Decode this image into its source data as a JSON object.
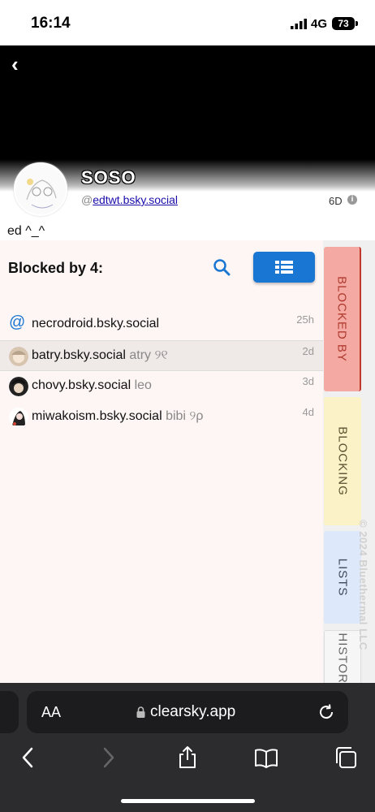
{
  "status_bar": {
    "time": "16:14",
    "network": "4G",
    "battery": "73"
  },
  "profile": {
    "display_name": "SOSO",
    "handle_prefix": "@",
    "handle": "edtwt.bsky.social",
    "age": "6D",
    "bio": "ed ^_^"
  },
  "panel": {
    "title": "Blocked by 4:",
    "rows": [
      {
        "handle": "necrodroid.bsky.social",
        "alias": "",
        "time": "25h",
        "avatar": "at-icon"
      },
      {
        "handle": "batry.bsky.social",
        "alias": "atry ୨୧",
        "time": "2d",
        "avatar": "avatar"
      },
      {
        "handle": "chovy.bsky.social",
        "alias": "leo",
        "time": "3d",
        "avatar": "avatar"
      },
      {
        "handle": "miwakoism.bsky.social",
        "alias": "bibi ୨ρ",
        "time": "4d",
        "avatar": "avatar"
      }
    ]
  },
  "tabs": {
    "blocked_by": "BLOCKED BY",
    "blocking": "BLOCKING",
    "lists": "LISTS",
    "history": "HISTORY"
  },
  "copyright": "© 2024 Bluethermal LLC",
  "browser": {
    "aa": "AA",
    "url": "clearsky.app"
  },
  "colors": {
    "accent": "#1976d2",
    "blocked_by_tab": "#f4a9a3",
    "blocking_tab": "#fbf3c7",
    "lists_tab": "#dde8fb"
  }
}
